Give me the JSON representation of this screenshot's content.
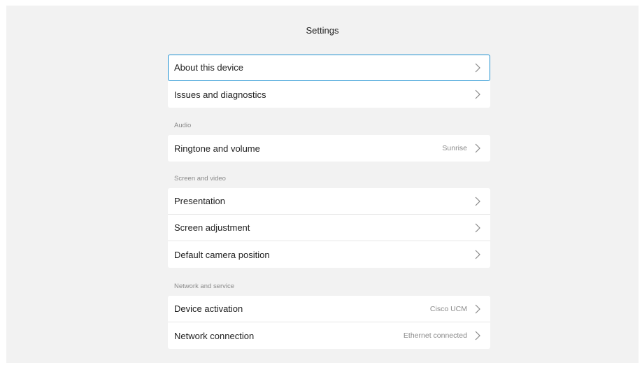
{
  "header": {
    "title": "Settings"
  },
  "groups": {
    "general": [
      {
        "label": "About this device",
        "value": ""
      },
      {
        "label": "Issues and diagnostics",
        "value": ""
      }
    ],
    "audio": {
      "label": "Audio",
      "items": [
        {
          "label": "Ringtone and volume",
          "value": "Sunrise"
        }
      ]
    },
    "screen": {
      "label": "Screen and video",
      "items": [
        {
          "label": "Presentation",
          "value": ""
        },
        {
          "label": "Screen adjustment",
          "value": ""
        },
        {
          "label": "Default camera position",
          "value": ""
        }
      ]
    },
    "network": {
      "label": "Network and service",
      "items": [
        {
          "label": "Device activation",
          "value": "Cisco UCM"
        },
        {
          "label": "Network connection",
          "value": "Ethernet connected"
        }
      ]
    }
  },
  "icons": {
    "row_chevron": "chevron-right-icon"
  },
  "colors": {
    "selection_outline": "#1b8fd0",
    "panel_background": "#f2f2f2"
  }
}
